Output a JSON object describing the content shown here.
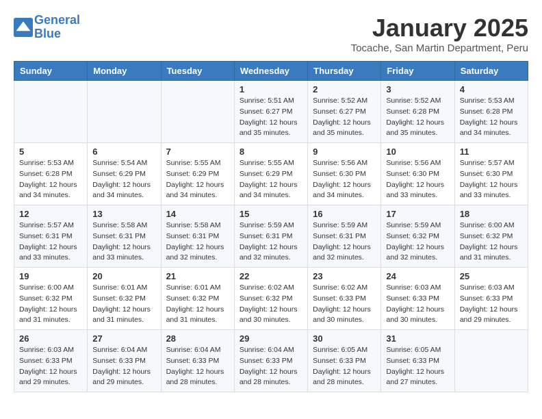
{
  "header": {
    "logo": "GeneralBlue",
    "month": "January 2025",
    "location": "Tocache, San Martin Department, Peru"
  },
  "weekdays": [
    "Sunday",
    "Monday",
    "Tuesday",
    "Wednesday",
    "Thursday",
    "Friday",
    "Saturday"
  ],
  "weeks": [
    [
      {
        "day": "",
        "info": ""
      },
      {
        "day": "",
        "info": ""
      },
      {
        "day": "",
        "info": ""
      },
      {
        "day": "1",
        "info": "Sunrise: 5:51 AM\nSunset: 6:27 PM\nDaylight: 12 hours\nand 35 minutes."
      },
      {
        "day": "2",
        "info": "Sunrise: 5:52 AM\nSunset: 6:27 PM\nDaylight: 12 hours\nand 35 minutes."
      },
      {
        "day": "3",
        "info": "Sunrise: 5:52 AM\nSunset: 6:28 PM\nDaylight: 12 hours\nand 35 minutes."
      },
      {
        "day": "4",
        "info": "Sunrise: 5:53 AM\nSunset: 6:28 PM\nDaylight: 12 hours\nand 34 minutes."
      }
    ],
    [
      {
        "day": "5",
        "info": "Sunrise: 5:53 AM\nSunset: 6:28 PM\nDaylight: 12 hours\nand 34 minutes."
      },
      {
        "day": "6",
        "info": "Sunrise: 5:54 AM\nSunset: 6:29 PM\nDaylight: 12 hours\nand 34 minutes."
      },
      {
        "day": "7",
        "info": "Sunrise: 5:55 AM\nSunset: 6:29 PM\nDaylight: 12 hours\nand 34 minutes."
      },
      {
        "day": "8",
        "info": "Sunrise: 5:55 AM\nSunset: 6:29 PM\nDaylight: 12 hours\nand 34 minutes."
      },
      {
        "day": "9",
        "info": "Sunrise: 5:56 AM\nSunset: 6:30 PM\nDaylight: 12 hours\nand 34 minutes."
      },
      {
        "day": "10",
        "info": "Sunrise: 5:56 AM\nSunset: 6:30 PM\nDaylight: 12 hours\nand 33 minutes."
      },
      {
        "day": "11",
        "info": "Sunrise: 5:57 AM\nSunset: 6:30 PM\nDaylight: 12 hours\nand 33 minutes."
      }
    ],
    [
      {
        "day": "12",
        "info": "Sunrise: 5:57 AM\nSunset: 6:31 PM\nDaylight: 12 hours\nand 33 minutes."
      },
      {
        "day": "13",
        "info": "Sunrise: 5:58 AM\nSunset: 6:31 PM\nDaylight: 12 hours\nand 33 minutes."
      },
      {
        "day": "14",
        "info": "Sunrise: 5:58 AM\nSunset: 6:31 PM\nDaylight: 12 hours\nand 32 minutes."
      },
      {
        "day": "15",
        "info": "Sunrise: 5:59 AM\nSunset: 6:31 PM\nDaylight: 12 hours\nand 32 minutes."
      },
      {
        "day": "16",
        "info": "Sunrise: 5:59 AM\nSunset: 6:31 PM\nDaylight: 12 hours\nand 32 minutes."
      },
      {
        "day": "17",
        "info": "Sunrise: 5:59 AM\nSunset: 6:32 PM\nDaylight: 12 hours\nand 32 minutes."
      },
      {
        "day": "18",
        "info": "Sunrise: 6:00 AM\nSunset: 6:32 PM\nDaylight: 12 hours\nand 31 minutes."
      }
    ],
    [
      {
        "day": "19",
        "info": "Sunrise: 6:00 AM\nSunset: 6:32 PM\nDaylight: 12 hours\nand 31 minutes."
      },
      {
        "day": "20",
        "info": "Sunrise: 6:01 AM\nSunset: 6:32 PM\nDaylight: 12 hours\nand 31 minutes."
      },
      {
        "day": "21",
        "info": "Sunrise: 6:01 AM\nSunset: 6:32 PM\nDaylight: 12 hours\nand 31 minutes."
      },
      {
        "day": "22",
        "info": "Sunrise: 6:02 AM\nSunset: 6:32 PM\nDaylight: 12 hours\nand 30 minutes."
      },
      {
        "day": "23",
        "info": "Sunrise: 6:02 AM\nSunset: 6:33 PM\nDaylight: 12 hours\nand 30 minutes."
      },
      {
        "day": "24",
        "info": "Sunrise: 6:03 AM\nSunset: 6:33 PM\nDaylight: 12 hours\nand 30 minutes."
      },
      {
        "day": "25",
        "info": "Sunrise: 6:03 AM\nSunset: 6:33 PM\nDaylight: 12 hours\nand 29 minutes."
      }
    ],
    [
      {
        "day": "26",
        "info": "Sunrise: 6:03 AM\nSunset: 6:33 PM\nDaylight: 12 hours\nand 29 minutes."
      },
      {
        "day": "27",
        "info": "Sunrise: 6:04 AM\nSunset: 6:33 PM\nDaylight: 12 hours\nand 29 minutes."
      },
      {
        "day": "28",
        "info": "Sunrise: 6:04 AM\nSunset: 6:33 PM\nDaylight: 12 hours\nand 28 minutes."
      },
      {
        "day": "29",
        "info": "Sunrise: 6:04 AM\nSunset: 6:33 PM\nDaylight: 12 hours\nand 28 minutes."
      },
      {
        "day": "30",
        "info": "Sunrise: 6:05 AM\nSunset: 6:33 PM\nDaylight: 12 hours\nand 28 minutes."
      },
      {
        "day": "31",
        "info": "Sunrise: 6:05 AM\nSunset: 6:33 PM\nDaylight: 12 hours\nand 27 minutes."
      },
      {
        "day": "",
        "info": ""
      }
    ]
  ]
}
